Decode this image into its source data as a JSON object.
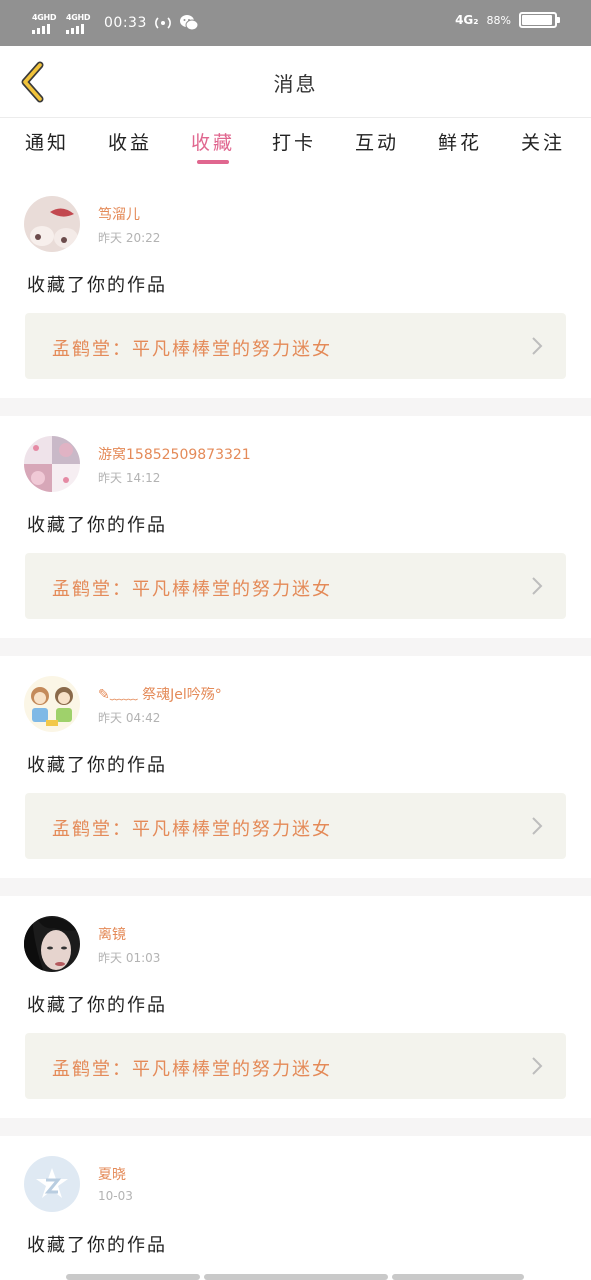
{
  "status_bar": {
    "sim1_label": "4GHD",
    "sim2_label": "4GHD",
    "time": "00:33",
    "network": "4G₂",
    "battery_text": "88%",
    "battery_level": 0.88
  },
  "header": {
    "title": "消息"
  },
  "tabs": [
    {
      "label": "通知"
    },
    {
      "label": "收益"
    },
    {
      "label": "收藏",
      "active": true
    },
    {
      "label": "打卡"
    },
    {
      "label": "互动"
    },
    {
      "label": "鲜花"
    },
    {
      "label": "关注"
    }
  ],
  "messages": [
    {
      "username": "笃溜儿",
      "time": "昨天 20:22",
      "action": "收藏了你的作品",
      "work": "孟鹤堂：平凡棒棒堂的努力迷女"
    },
    {
      "username": "游窝15852509873321",
      "time": "昨天 14:12",
      "action": "收藏了你的作品",
      "work": "孟鹤堂：平凡棒棒堂的努力迷女"
    },
    {
      "username": "✎﹏﹏ 祭魂Jel吟殇°",
      "time": "昨天 04:42",
      "action": "收藏了你的作品",
      "work": "孟鹤堂：平凡棒棒堂的努力迷女"
    },
    {
      "username": "离镜",
      "time": "昨天 01:03",
      "action": "收藏了你的作品",
      "work": "孟鹤堂：平凡棒棒堂的努力迷女"
    },
    {
      "username": "夏晓",
      "time": "10-03",
      "action": "收藏了你的作品",
      "work": ""
    }
  ],
  "colors": {
    "accent_pink": "#e0678f",
    "orange_text": "#e48a58",
    "status_bar": "#919191",
    "work_box_bg": "#f3f3ed",
    "back_icon": "#d9a825"
  },
  "icons": {
    "back": "chevron-left-icon",
    "wechat": "wechat-icon",
    "hotspot": "hotspot-icon",
    "chevron": "chevron-right-icon"
  }
}
